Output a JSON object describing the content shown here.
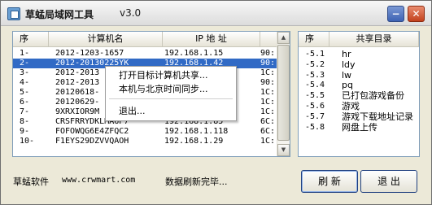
{
  "window": {
    "title": "草蜢局域网工具",
    "version": "v3.0",
    "minimize_glyph": "−",
    "close_glyph": "✕"
  },
  "computer_list": {
    "columns": [
      "序",
      "计算机名",
      "IP 地 址",
      ""
    ],
    "rows": [
      {
        "no": "1-",
        "name": "2012-1203-1657",
        "ip": "192.168.1.15",
        "extra": "90:"
      },
      {
        "no": "2-",
        "name": "2012-20130225YK",
        "ip": "192.168.1.42",
        "extra": "90:"
      },
      {
        "no": "3-",
        "name": "2012-2013",
        "ip": "",
        "extra": "1C:"
      },
      {
        "no": "4-",
        "name": "2012-2013",
        "ip": "",
        "extra": "90:"
      },
      {
        "no": "5-",
        "name": "20120618-",
        "ip": "",
        "extra": "1C:"
      },
      {
        "no": "6-",
        "name": "20120629-",
        "ip": "",
        "extra": "1C:"
      },
      {
        "no": "7-",
        "name": "9XRXIOR9M",
        "ip": "",
        "extra": "1C:"
      },
      {
        "no": "8-",
        "name": "CRSFRRYDKLMA6P7",
        "ip": "192.168.1.85",
        "extra": "6C:"
      },
      {
        "no": "9-",
        "name": "FOFOWQG6E4ZFQC2",
        "ip": "192.168.1.118",
        "extra": "6C:"
      },
      {
        "no": "10-",
        "name": "F1EYS29DZVVQAOH",
        "ip": "192.168.1.29",
        "extra": "1C:"
      }
    ],
    "selected_index": 1
  },
  "share_list": {
    "columns": [
      "序",
      "共享目录"
    ],
    "rows": [
      {
        "no": "-5.1",
        "name": "hr"
      },
      {
        "no": "-5.2",
        "name": "ldy"
      },
      {
        "no": "-5.3",
        "name": "lw"
      },
      {
        "no": "-5.4",
        "name": "pq"
      },
      {
        "no": "-5.5",
        "name": "已打包游戏备份"
      },
      {
        "no": "-5.6",
        "name": "游戏"
      },
      {
        "no": "-5.7",
        "name": "游戏下载地址记录"
      },
      {
        "no": "-5.8",
        "name": "网盘上传"
      }
    ]
  },
  "context_menu": {
    "items": [
      "打开目标计算机共享...",
      "本机与北京时间同步...",
      "退出..."
    ]
  },
  "footer": {
    "brand": "草蜢软件",
    "url": "www.crwmart.com",
    "status": "数据刷新完毕...",
    "refresh_label": "刷 新",
    "exit_label": "退 出"
  }
}
